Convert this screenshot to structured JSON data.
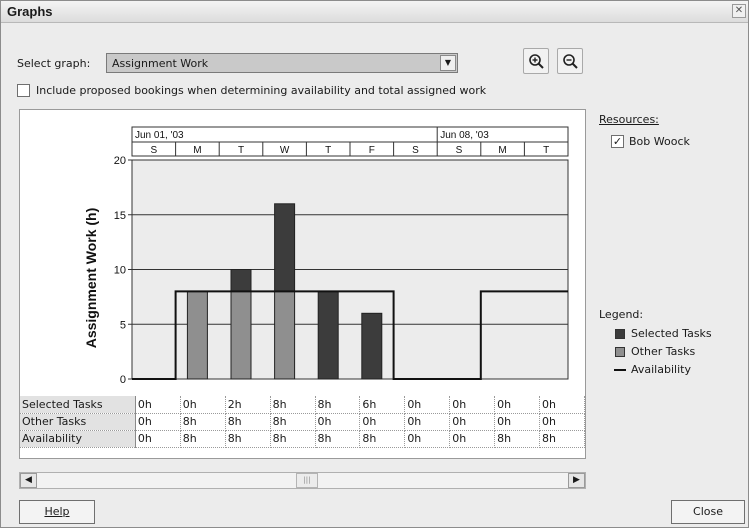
{
  "window": {
    "title": "Graphs"
  },
  "controls": {
    "select_graph_label": "Select graph:",
    "select_graph_value": "Assignment Work",
    "include_proposed_label": "Include proposed bookings when determining availability and total assigned work",
    "include_proposed_checked": false
  },
  "resources": {
    "label": "Resources:",
    "items": [
      {
        "name": "Bob Woock",
        "checked": true
      }
    ]
  },
  "legend": {
    "label": "Legend:",
    "items": [
      {
        "name": "Selected Tasks",
        "color": "#3c3c3c"
      },
      {
        "name": "Other Tasks",
        "color": "#8f8f8f"
      },
      {
        "name": "Availability",
        "color": "#111111"
      }
    ]
  },
  "chart_data": {
    "type": "bar",
    "ylabel": "Assignment Work (h)",
    "ylim": [
      0,
      20
    ],
    "y_ticks": [
      "0",
      "5",
      "10",
      "15",
      "20"
    ],
    "weeks": [
      "Jun 01, '03",
      "Jun 08, '03"
    ],
    "categories": [
      "S",
      "M",
      "T",
      "W",
      "T",
      "F",
      "S",
      "S",
      "M",
      "T"
    ],
    "series": [
      {
        "name": "Selected Tasks",
        "values": [
          0,
          0,
          2,
          8,
          8,
          6,
          0,
          0,
          0,
          0
        ]
      },
      {
        "name": "Other Tasks",
        "values": [
          0,
          8,
          8,
          8,
          0,
          0,
          0,
          0,
          0,
          0
        ]
      },
      {
        "name": "Availability",
        "values": [
          0,
          8,
          8,
          8,
          8,
          8,
          0,
          0,
          8,
          8
        ]
      }
    ]
  },
  "table": {
    "rows": [
      {
        "label": "Selected Tasks",
        "values": [
          "0h",
          "0h",
          "2h",
          "8h",
          "8h",
          "6h",
          "0h",
          "0h",
          "0h",
          "0h"
        ]
      },
      {
        "label": "Other Tasks",
        "values": [
          "0h",
          "8h",
          "8h",
          "8h",
          "0h",
          "0h",
          "0h",
          "0h",
          "0h",
          "0h"
        ]
      },
      {
        "label": "Availability",
        "values": [
          "0h",
          "8h",
          "8h",
          "8h",
          "8h",
          "8h",
          "0h",
          "0h",
          "8h",
          "8h"
        ]
      }
    ]
  },
  "buttons": {
    "help": "Help",
    "close": "Close"
  },
  "colors": {
    "selected": "#3c3c3c",
    "other": "#8f8f8f",
    "plot_bg": "#ececec"
  }
}
